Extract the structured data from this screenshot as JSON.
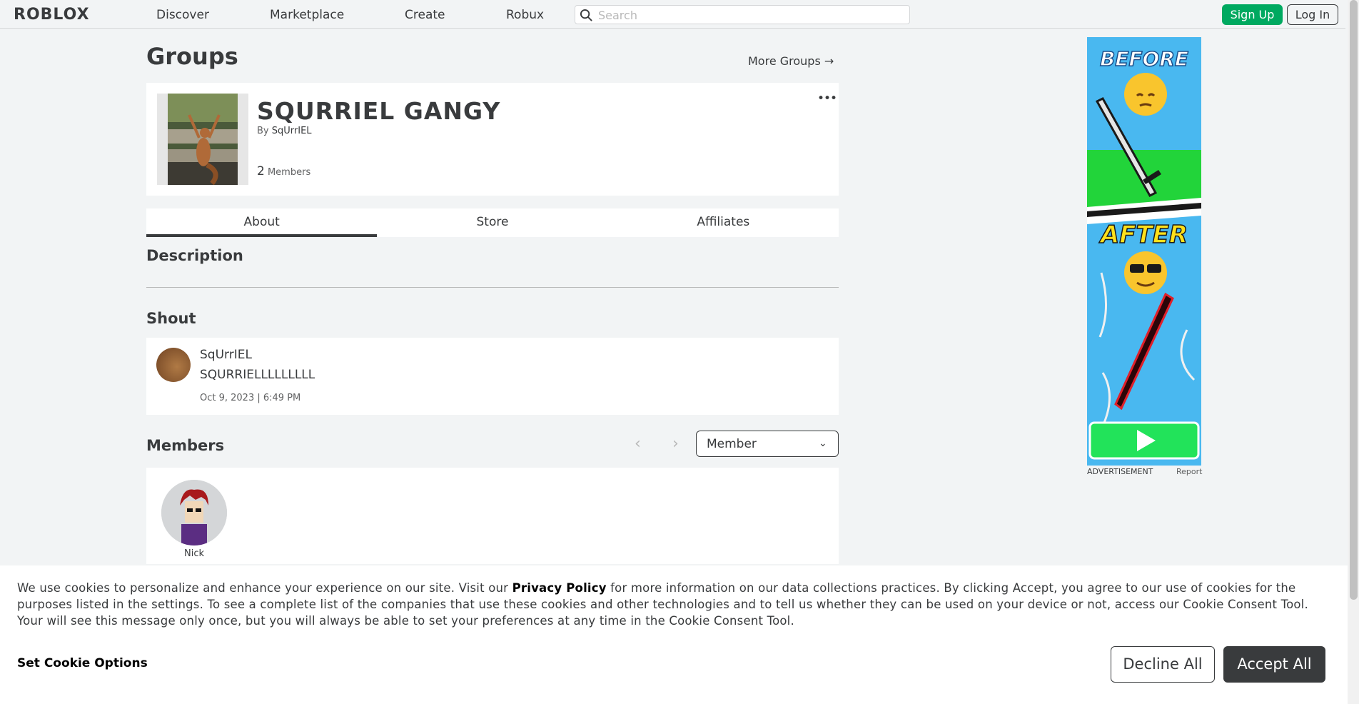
{
  "nav": {
    "logo": "ROBLOX",
    "links": [
      "Discover",
      "Marketplace",
      "Create",
      "Robux"
    ],
    "search_placeholder": "Search",
    "signup_label": "Sign Up",
    "login_label": "Log In"
  },
  "page": {
    "title": "Groups",
    "more_groups": "More Groups →"
  },
  "group": {
    "name": "SQURRIEL GANGY",
    "by_label": "By",
    "owner": "SqUrrIEL",
    "member_count": "2",
    "members_label": "Members",
    "more_menu": "•••"
  },
  "tabs": [
    "About",
    "Store",
    "Affiliates"
  ],
  "sections": {
    "description": "Description",
    "shout": "Shout",
    "members": "Members"
  },
  "shout": {
    "user": "SqUrrIEL",
    "text": "SQURRIELLLLLLLLL",
    "date": "Oct 9, 2023 | 6:49 PM"
  },
  "members": {
    "role_selected": "Member",
    "list": [
      {
        "name": "Nick"
      }
    ]
  },
  "ad": {
    "before": "BEFORE",
    "after": "AFTER",
    "label": "ADVERTISEMENT",
    "report": "Report"
  },
  "cookie": {
    "text_before": "We use cookies to personalize and enhance your experience on our site. Visit our ",
    "privacy_link": "Privacy Policy",
    "text_after": " for more information on our data collections practices. By clicking Accept, you agree to our use of cookies for the purposes listed in the settings. To see a complete list of the companies that use these cookies and other technologies and to tell us whether they can be used on your device or not, access our Cookie Consent Tool. Your will see this message only once, but you will always be able to set your preferences at any time in the Cookie Consent Tool.",
    "options": "Set Cookie Options",
    "decline": "Decline All",
    "accept": "Accept All"
  },
  "colors": {
    "accent_green": "#00a960",
    "text_dark": "#393b3d",
    "background": "#f2f4f5"
  }
}
